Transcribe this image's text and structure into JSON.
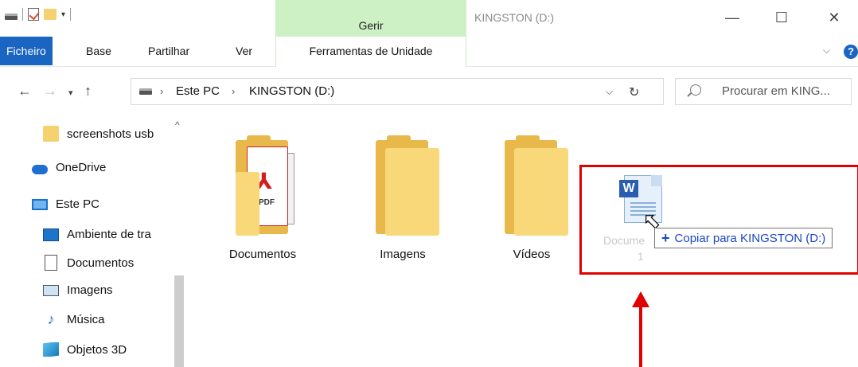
{
  "titlebar": {
    "gerir_label": "Gerir",
    "window_title": "KINGSTON (D:)",
    "minimize_glyph": "—",
    "maximize_glyph": "☐",
    "close_glyph": "✕"
  },
  "ribbon": {
    "tabs": [
      "Ficheiro",
      "Base",
      "Partilhar",
      "Ver"
    ],
    "context_tab": "Ferramentas de Unidade",
    "help_glyph": "?"
  },
  "address": {
    "crumbs": [
      "Este PC",
      "KINGSTON (D:)"
    ],
    "search_placeholder": "Procurar em KING..."
  },
  "sidebar": {
    "items": [
      {
        "label": "screenshots usb",
        "icon": "folder-icon"
      },
      {
        "label": "OneDrive",
        "icon": "cloud-icon"
      },
      {
        "label": "Este PC",
        "icon": "pc-icon"
      },
      {
        "label": "Ambiente de tra",
        "icon": "desktop-icon"
      },
      {
        "label": "Documentos",
        "icon": "document-icon"
      },
      {
        "label": "Imagens",
        "icon": "image-icon"
      },
      {
        "label": "Música",
        "icon": "music-icon"
      },
      {
        "label": "Objetos 3D",
        "icon": "cube-icon"
      }
    ]
  },
  "content": {
    "folders": [
      "Documentos",
      "Imagens",
      "Vídeos"
    ],
    "dragged_label_line1": "Docume",
    "dragged_label_line2": "1",
    "tooltip": "Copiar para KINGSTON (D:)"
  },
  "colors": {
    "accent": "#1a64c2",
    "gerir_tab": "#cdf0c4",
    "highlight": "#e10000"
  }
}
